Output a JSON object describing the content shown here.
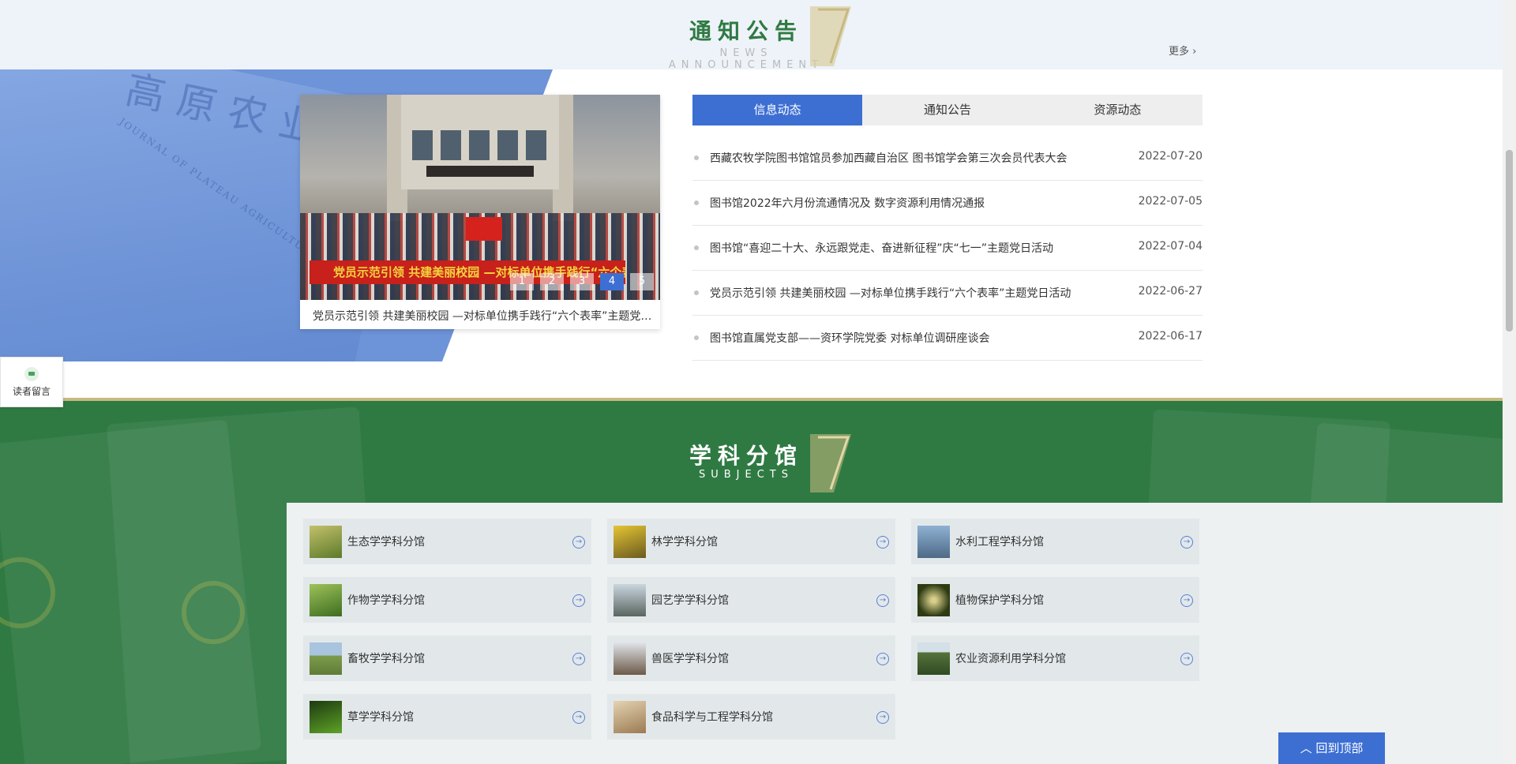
{
  "announcement": {
    "title_zh": "通知公告",
    "title_en": "NEWS ANNOUNCEMENT",
    "more_label": "更多 ›",
    "bg_book_title": "高原农业",
    "bg_book_subtitle": "JOURNAL OF PLATEAU AGRICULTURE",
    "slider": {
      "banner_text": "党员示范引领 共建美丽校园 —对标单位携手践行“六个表率”主题党日活动",
      "caption": "党员示范引领 共建美丽校园 —对标单位携手践行“六个表率”主题党日活动",
      "pages": [
        "1",
        "2",
        "3",
        "4",
        "5"
      ],
      "active_page": "4"
    },
    "tabs": [
      {
        "label": "信息动态",
        "active": true
      },
      {
        "label": "通知公告",
        "active": false
      },
      {
        "label": "资源动态",
        "active": false
      }
    ],
    "news": [
      {
        "title": "西藏农牧学院图书馆馆员参加西藏自治区 图书馆学会第三次会员代表大会",
        "date": "2022-07-20"
      },
      {
        "title": "图书馆2022年六月份流通情况及 数字资源利用情况通报",
        "date": "2022-07-05"
      },
      {
        "title": "图书馆“喜迎二十大、永远跟党走、奋进新征程”庆“七一”主题党日活动",
        "date": "2022-07-04"
      },
      {
        "title": "党员示范引领 共建美丽校园 —对标单位携手践行“六个表率”主题党日活动",
        "date": "2022-06-27"
      },
      {
        "title": "图书馆直属党支部——资环学院党委 对标单位调研座谈会",
        "date": "2022-06-17"
      }
    ]
  },
  "reader_message": {
    "label": "读者留言",
    "icon": "chat-bubble-icon"
  },
  "subjects": {
    "title_zh": "学科分馆",
    "title_en": "SUBJECTS",
    "items": [
      {
        "label": "生态学学科分馆",
        "thumb_color": "#7e8f3a"
      },
      {
        "label": "林学学科分馆",
        "thumb_color": "#b9a431"
      },
      {
        "label": "水利工程学科分馆",
        "thumb_color": "#5b7a96"
      },
      {
        "label": "作物学学科分馆",
        "thumb_color": "#5e8a2c"
      },
      {
        "label": "园艺学学科分馆",
        "thumb_color": "#6d7a7c"
      },
      {
        "label": "植物保护学科分馆",
        "thumb_color": "#3d4a20"
      },
      {
        "label": "畜牧学学科分馆",
        "thumb_color": "#7a9a5c"
      },
      {
        "label": "兽医学学科分馆",
        "thumb_color": "#8a7c68"
      },
      {
        "label": "农业资源利用学科分馆",
        "thumb_color": "#4d6a3a"
      },
      {
        "label": "草学学科分馆",
        "thumb_color": "#3e7a1f"
      },
      {
        "label": "食品科学与工程学科分馆",
        "thumb_color": "#b59a72"
      }
    ]
  },
  "back_to_top": "回到顶部",
  "colors": {
    "accent_blue": "#3d6fd3",
    "green": "#2f7a43",
    "gold": "#c8b981"
  }
}
